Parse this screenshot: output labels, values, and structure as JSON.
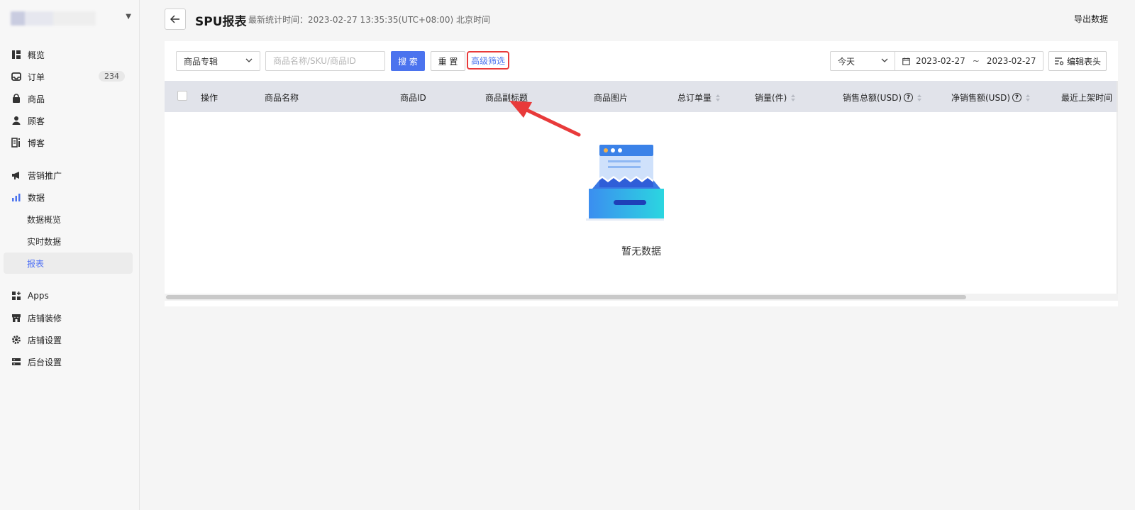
{
  "sidebar": {
    "items": [
      {
        "label": "概览",
        "icon": "overview-icon"
      },
      {
        "label": "订单",
        "icon": "inbox-icon",
        "badge": "234"
      },
      {
        "label": "商品",
        "icon": "bag-icon"
      },
      {
        "label": "顾客",
        "icon": "person-icon"
      },
      {
        "label": "博客",
        "icon": "blog-icon"
      },
      {
        "label": "营销推广",
        "icon": "megaphone-icon"
      },
      {
        "label": "数据",
        "icon": "bar-chart-icon"
      },
      {
        "label": "数据概览",
        "sub": true
      },
      {
        "label": "实时数据",
        "sub": true
      },
      {
        "label": "报表",
        "sub": true,
        "active": true
      },
      {
        "label": "Apps",
        "icon": "apps-icon"
      },
      {
        "label": "店铺装修",
        "icon": "store-icon"
      },
      {
        "label": "店铺设置",
        "icon": "gear-icon"
      },
      {
        "label": "后台设置",
        "icon": "server-icon"
      }
    ]
  },
  "header": {
    "title": "SPU报表",
    "stat_time": "最新统计时间：2023-02-27 13:35:35(UTC+08:00) 北京时间",
    "export_label": "导出数据"
  },
  "filters": {
    "category_select": "商品专辑",
    "search_placeholder": "商品名称/SKU/商品ID",
    "search_label": "搜 索",
    "reset_label": "重 置",
    "advanced_label": "高级筛选",
    "date_range_select": "今天",
    "date_start": "2023-02-27",
    "date_sep": "~",
    "date_end": "2023-02-27",
    "edit_columns_label": "编辑表头"
  },
  "table": {
    "columns": [
      {
        "label": "操作"
      },
      {
        "label": "商品名称"
      },
      {
        "label": "商品ID"
      },
      {
        "label": "商品副标题"
      },
      {
        "label": "商品图片"
      },
      {
        "label": "总订单量",
        "sortable": true
      },
      {
        "label": "销量(件)",
        "sortable": true
      },
      {
        "label": "销售总额(USD)",
        "sortable": true,
        "help": true
      },
      {
        "label": "净销售额(USD)",
        "sortable": true,
        "help": true
      },
      {
        "label": "最近上架时间"
      }
    ],
    "empty_text": "暂无数据"
  },
  "colors": {
    "accent": "#4b73ee",
    "annotation": "#e83a3a"
  }
}
